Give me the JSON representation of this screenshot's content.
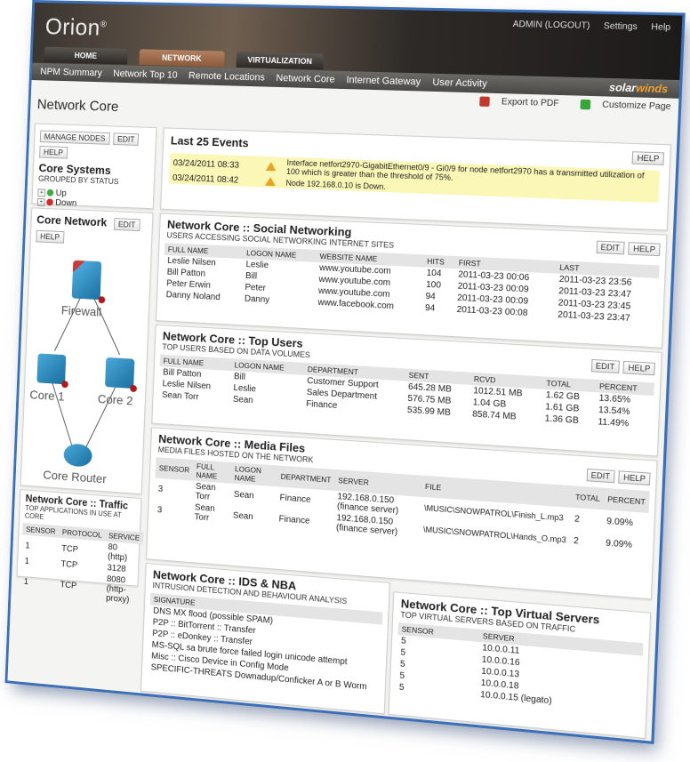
{
  "app": {
    "logo": "Orion",
    "logo_mark": "®"
  },
  "top_links": [
    "ADMIN (LOGOUT)",
    "Settings",
    "Help"
  ],
  "main_tabs": [
    {
      "label": "HOME",
      "active": false
    },
    {
      "label": "NETWORK",
      "active": true
    },
    {
      "label": "VIRTUALIZATION",
      "active": false
    }
  ],
  "sub_nav": [
    "NPM Summary",
    "Network Top 10",
    "Remote Locations",
    "Network Core",
    "Internet Gateway",
    "User Activity"
  ],
  "brand": {
    "prefix": "solar",
    "suffix": "winds"
  },
  "page_title": "Network Core",
  "page_actions": {
    "export": "Export to PDF",
    "customize": "Customize Page"
  },
  "buttons": {
    "manage_nodes": "MANAGE NODES",
    "edit": "EDIT",
    "help": "HELP"
  },
  "core_systems": {
    "title": "Core Systems",
    "subtitle": "GROUPED BY STATUS",
    "groups": [
      {
        "label": "Up",
        "color": "#3dad3d"
      },
      {
        "label": "Down",
        "color": "#d22a2a"
      }
    ]
  },
  "core_network": {
    "title": "Core Network",
    "nodes": {
      "firewall": "Firewall",
      "core1": "Core 1",
      "core2": "Core 2",
      "router": "Core Router"
    }
  },
  "events": {
    "title": "Last 25 Events",
    "rows": [
      {
        "time": "03/24/2011 08:33",
        "message": "Interface netfort2970-GigabitEthernet0/9 - Gi0/9 for node netfort2970 has a transmitted utilization of 100 which is greater than the threshold of 75%."
      },
      {
        "time": "03/24/2011 08:42",
        "message": "Node 192.168.0.10 is Down."
      }
    ]
  },
  "social": {
    "title": "Network Core :: Social Networking",
    "subtitle": "USERS ACCESSING SOCIAL NETWORKING INTERNET SITES",
    "columns": [
      "FULL NAME",
      "LOGON NAME",
      "WEBSITE NAME",
      "HITS",
      "FIRST",
      "LAST"
    ],
    "rows": [
      [
        "Leslie Nilsen",
        "Leslie",
        "www.youtube.com",
        "104",
        "2011-03-23 00:06",
        "2011-03-23 23:56"
      ],
      [
        "Bill Patton",
        "Bill",
        "www.youtube.com",
        "100",
        "2011-03-23 00:09",
        "2011-03-23 23:47"
      ],
      [
        "Peter Erwin",
        "Peter",
        "www.youtube.com",
        "94",
        "2011-03-23 00:09",
        "2011-03-23 23:45"
      ],
      [
        "Danny Noland",
        "Danny",
        "www.facebook.com",
        "94",
        "2011-03-23 00:08",
        "2011-03-23 23:47"
      ]
    ]
  },
  "top_users": {
    "title": "Network Core :: Top Users",
    "subtitle": "TOP USERS BASED ON DATA VOLUMES",
    "columns": [
      "FULL NAME",
      "LOGON NAME",
      "DEPARTMENT",
      "SENT",
      "RCVD",
      "TOTAL",
      "PERCENT"
    ],
    "rows": [
      [
        "Bill Patton",
        "Bill",
        "Customer Support",
        "645.28 MB",
        "1012.51 MB",
        "1.62 GB",
        "13.65%"
      ],
      [
        "Leslie Nilsen",
        "Leslie",
        "Sales Department",
        "576.75 MB",
        "1.04 GB",
        "1.61 GB",
        "13.54%"
      ],
      [
        "Sean Torr",
        "Sean",
        "Finance",
        "535.99 MB",
        "858.74 MB",
        "1.36 GB",
        "11.49%"
      ]
    ]
  },
  "media": {
    "title": "Network Core :: Media Files",
    "subtitle": "MEDIA FILES HOSTED ON THE NETWORK",
    "columns": [
      "SENSOR",
      "FULL NAME",
      "LOGON NAME",
      "DEPARTMENT",
      "SERVER",
      "FILE",
      "TOTAL",
      "PERCENT"
    ],
    "rows": [
      [
        "3",
        "Sean Torr",
        "Sean",
        "Finance",
        "192.168.0.150 (finance server)",
        "\\MUSIC\\SNOWPATROL\\Finish_L.mp3",
        "2",
        "9.09%"
      ],
      [
        "3",
        "Sean Torr",
        "Sean",
        "Finance",
        "192.168.0.150 (finance server)",
        "\\MUSIC\\SNOWPATROL\\Hands_O.mp3",
        "2",
        "9.09%"
      ]
    ]
  },
  "traffic": {
    "title": "Network Core :: Traffic",
    "subtitle": "TOP APPLICATIONS IN USE AT CORE",
    "columns": [
      "SENSOR",
      "PROTOCOL",
      "SERVICE"
    ],
    "rows": [
      [
        "1",
        "TCP",
        "80 (http)"
      ],
      [
        "1",
        "TCP",
        "3128"
      ],
      [
        "1",
        "TCP",
        "8080 (http-proxy)"
      ]
    ]
  },
  "ids": {
    "title": "Network Core :: IDS & NBA",
    "subtitle": "INTRUSION DETECTION AND BEHAVIOUR ANALYSIS",
    "columns": [
      "SIGNATURE"
    ],
    "rows": [
      "DNS MX flood (possible SPAM)",
      "P2P :: BitTorrent :: Transfer",
      "P2P :: eDonkey :: Transfer",
      "MS-SQL sa brute force failed login unicode attempt",
      "Misc :: Cisco Device in Config Mode",
      "SPECIFIC-THREATS Downadup/Conficker A or B Worm"
    ]
  },
  "virtual": {
    "title": "Network Core :: Top Virtual Servers",
    "subtitle": "TOP VIRTUAL SERVERS BASED ON TRAFFIC",
    "columns": [
      "SENSOR",
      "SERVER"
    ],
    "rows": [
      [
        "5",
        "10.0.0.11"
      ],
      [
        "5",
        "10.0.0.16"
      ],
      [
        "5",
        "10.0.0.13"
      ],
      [
        "5",
        "10.0.0.18"
      ],
      [
        "5",
        "10.0.0.15 (legato)"
      ]
    ]
  }
}
